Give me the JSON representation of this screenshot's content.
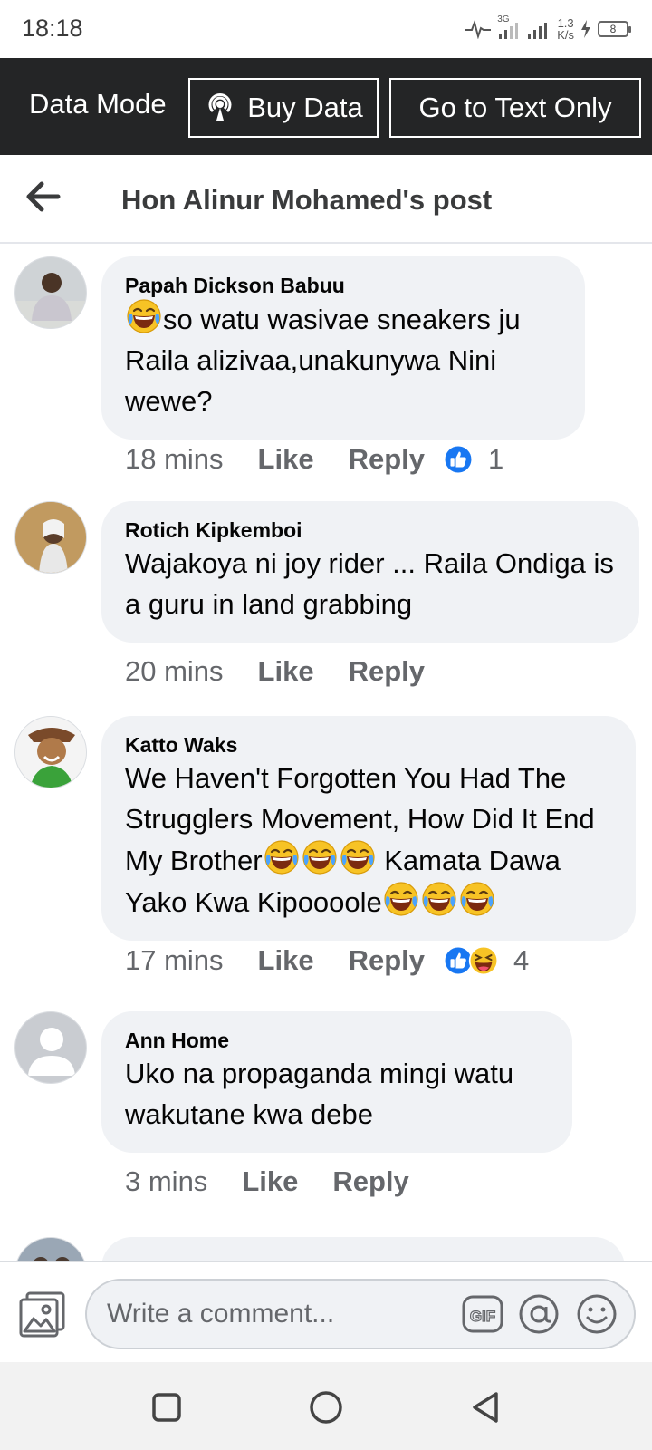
{
  "status_bar": {
    "time": "18:18",
    "network": "3G",
    "speed_value": "1.3",
    "speed_unit": "K/s",
    "battery": "8"
  },
  "data_bar": {
    "mode_label": "Data Mode",
    "buy_data_label": "Buy Data",
    "text_only_label": "Go to Text Only"
  },
  "header": {
    "title": "Hon Alinur Mohamed's post"
  },
  "comments": [
    {
      "author": "Papah Dickson Babuu",
      "text": "so watu wasivae sneakers ju Raila alizivaa,unakunywa Nini wewe?",
      "time": "18 mins",
      "like_label": "Like",
      "reply_label": "Reply",
      "reactions": [
        "like-reaction-icon"
      ],
      "reaction_count": "1"
    },
    {
      "author": "Rotich Kipkemboi",
      "text": "Wajakoya ni joy rider ... Raila Ondiga is a guru in land  grabbing",
      "time": "20 mins",
      "like_label": "Like",
      "reply_label": "Reply",
      "reactions": [],
      "reaction_count": ""
    },
    {
      "author": "Katto Waks",
      "text_line_a": "We Haven't Forgotten You Had The Strugglers Movement, How Did It End My Brother",
      "text_line_b": " Kamata Dawa Yako Kwa Kipoooole",
      "time": "17 mins",
      "like_label": "Like",
      "reply_label": "Reply",
      "reactions": [
        "like-reaction-icon",
        "haha-reaction-icon"
      ],
      "reaction_count": "4"
    },
    {
      "author": "Ann Home",
      "text": "Uko na propaganda mingi watu wakutane kwa debe",
      "time": "3 mins",
      "like_label": "Like",
      "reply_label": "Reply",
      "reactions": [],
      "reaction_count": ""
    }
  ],
  "composer": {
    "placeholder": "Write a comment...",
    "gif_label": "GIF"
  },
  "colors": {
    "data_bar_bg": "#242526",
    "bubble_bg": "#f0f2f5",
    "like_blue": "#1877f2",
    "meta_gray": "#65676b"
  }
}
